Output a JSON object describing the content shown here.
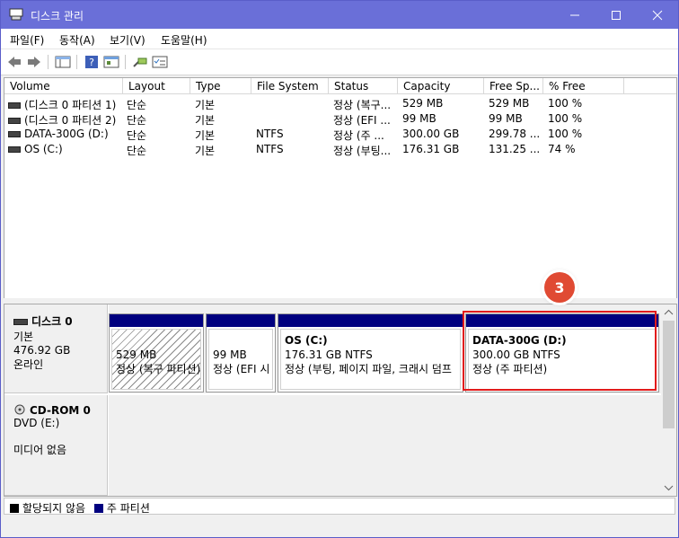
{
  "window": {
    "title": "디스크 관리"
  },
  "menu": [
    "파일(F)",
    "동작(A)",
    "보기(V)",
    "도움말(H)"
  ],
  "columns": [
    "Volume",
    "Layout",
    "Type",
    "File System",
    "Status",
    "Capacity",
    "Free Sp...",
    "% Free"
  ],
  "volumes": [
    [
      "(디스크 0 파티션 1)",
      "단순",
      "기본",
      "",
      "정상 (복구...",
      "529 MB",
      "529 MB",
      "100 %"
    ],
    [
      "(디스크 0 파티션 2)",
      "단순",
      "기본",
      "",
      "정상 (EFI ...",
      "99 MB",
      "99 MB",
      "100 %"
    ],
    [
      "DATA-300G (D:)",
      "단순",
      "기본",
      "NTFS",
      "정상 (주 ...",
      "300.00 GB",
      "299.78 ...",
      "100 %"
    ],
    [
      "OS (C:)",
      "단순",
      "기본",
      "NTFS",
      "정상 (부팅...",
      "176.31 GB",
      "131.25 ...",
      "74 %"
    ]
  ],
  "disk0": {
    "name": "디스크 0",
    "type": "기본",
    "size": "476.92 GB",
    "state": "온라인",
    "partitions": [
      {
        "title": "",
        "line1": "529 MB",
        "line2": "정상 (복구 파티션)"
      },
      {
        "title": "",
        "line1": "99 MB",
        "line2": "정상 (EFI 시"
      },
      {
        "title": "OS  (C:)",
        "line1": "176.31 GB NTFS",
        "line2": "정상 (부팅, 페이지 파일, 크래시 덤프"
      },
      {
        "title": "DATA-300G  (D:)",
        "line1": "300.00 GB NTFS",
        "line2": "정상 (주 파티션)"
      }
    ]
  },
  "cdrom": {
    "name": "CD-ROM 0",
    "drive": "DVD (E:)",
    "state": "미디어 없음"
  },
  "legend": {
    "unallocated": "할당되지 않음",
    "primary": "주 파티션"
  },
  "badge": "3",
  "colors": {
    "titlebar": "#6a6fd8",
    "primary": "#00007f",
    "highlight": "#e21b1b",
    "badge": "#e04a33"
  }
}
